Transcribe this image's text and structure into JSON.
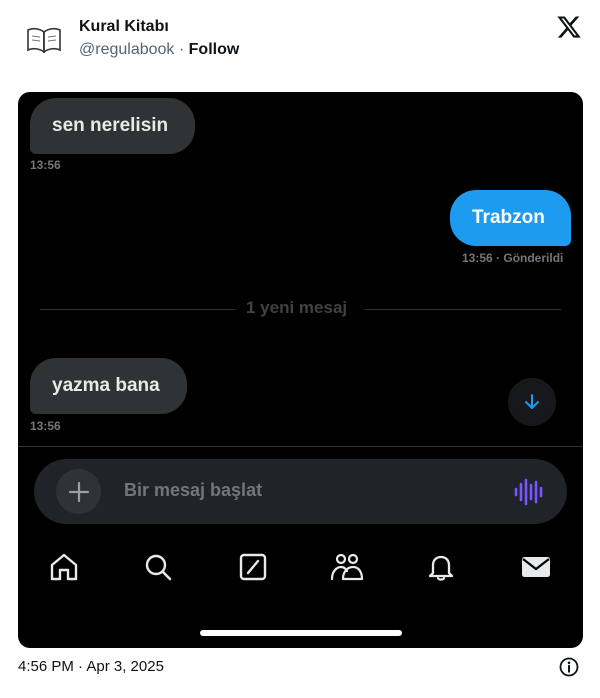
{
  "tweet": {
    "author_name": "Kural Kitabı",
    "author_handle": "@regulabook",
    "separator": " · ",
    "follow_label": "Follow",
    "timestamp": "4:56 PM · Apr 3, 2025"
  },
  "chat": {
    "messages": [
      {
        "direction": "received",
        "text": "sen nerelisin",
        "time": "13:56"
      },
      {
        "direction": "sent",
        "text": "Trabzon",
        "time": "13:56 · Gönderildi"
      },
      {
        "direction": "received",
        "text": "yazma bana",
        "time": "13:56"
      }
    ],
    "new_messages_divider": "1 yeni mesaj",
    "composer_placeholder": "Bir mesaj başlat"
  },
  "tabbar": [
    "home-icon",
    "search-icon",
    "grok-icon",
    "communities-icon",
    "notifications-icon",
    "messages-icon"
  ],
  "colors": {
    "sent_bubble": "#1d9bf0",
    "received_bubble": "#2f3336",
    "voice_accent": "#7856ff",
    "scroll_arrow": "#1d9bf0"
  }
}
